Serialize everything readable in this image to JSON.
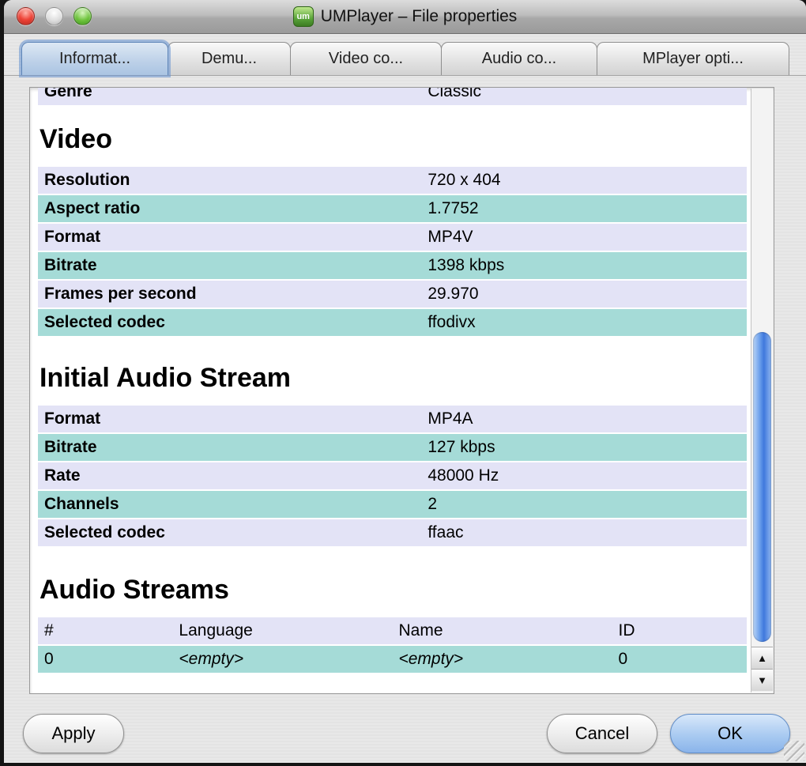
{
  "window": {
    "title": "UMPlayer – File properties",
    "app_icon_text": "um"
  },
  "tabs": {
    "selected_index": 0,
    "items": [
      {
        "label": "Informat..."
      },
      {
        "label": "Demu..."
      },
      {
        "label": "Video co..."
      },
      {
        "label": "Audio co..."
      },
      {
        "label": "MPlayer opti..."
      }
    ]
  },
  "info": {
    "clipped_row": {
      "label": "Genre",
      "value": "Classic"
    },
    "video": {
      "title": "Video",
      "rows": [
        {
          "label": "Resolution",
          "value": "720 x 404"
        },
        {
          "label": "Aspect ratio",
          "value": "1.7752"
        },
        {
          "label": "Format",
          "value": "MP4V"
        },
        {
          "label": "Bitrate",
          "value": "1398 kbps"
        },
        {
          "label": "Frames per second",
          "value": "29.970"
        },
        {
          "label": "Selected codec",
          "value": "ffodivx"
        }
      ]
    },
    "initial_audio": {
      "title": "Initial Audio Stream",
      "rows": [
        {
          "label": "Format",
          "value": "MP4A"
        },
        {
          "label": "Bitrate",
          "value": "127 kbps"
        },
        {
          "label": "Rate",
          "value": "48000 Hz"
        },
        {
          "label": "Channels",
          "value": "2"
        },
        {
          "label": "Selected codec",
          "value": "ffaac"
        }
      ]
    },
    "audio_streams": {
      "title": "Audio Streams",
      "headers": {
        "num": "#",
        "language": "Language",
        "name": "Name",
        "id": "ID"
      },
      "rows": [
        {
          "num": "0",
          "language": "<empty>",
          "name": "<empty>",
          "id": "0"
        }
      ]
    }
  },
  "scrollbar": {
    "up_icon": "▲",
    "down_icon": "▼"
  },
  "footer": {
    "apply_label": "Apply",
    "cancel_label": "Cancel",
    "ok_label": "OK"
  },
  "colors": {
    "row_lavender": "#e3e3f6",
    "row_teal": "#a5dbd7",
    "selected_tab_fill": "#bcd0e8",
    "selected_tab_ring": "#6290d0",
    "scroll_thumb_blue": "#3f78dd",
    "ok_button_blue": "#a9caf1"
  }
}
